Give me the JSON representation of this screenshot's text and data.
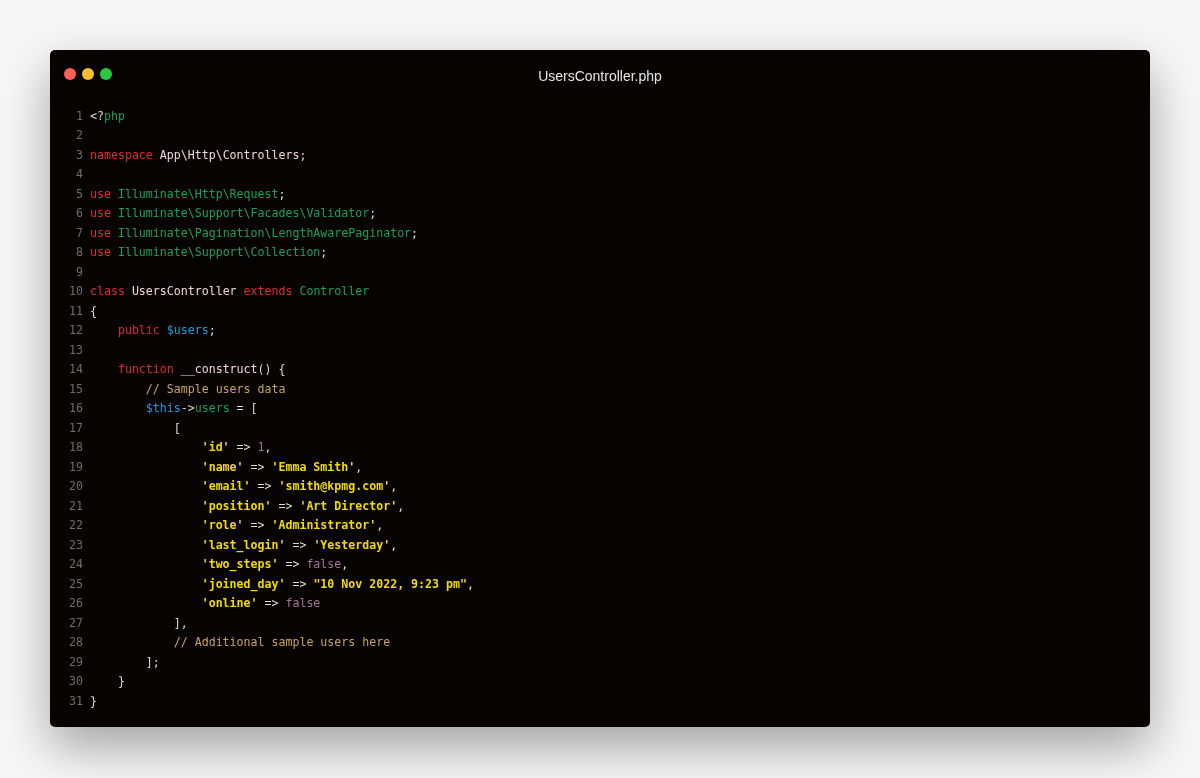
{
  "window": {
    "title": "UsersController.php"
  },
  "lines": [
    {
      "number": "1",
      "tokens": [
        {
          "text": "<?",
          "kind": "plain"
        },
        {
          "text": "php",
          "kind": "type"
        }
      ]
    },
    {
      "number": "2"
    },
    {
      "number": "3",
      "tokens": [
        {
          "text": "namespace",
          "kind": "keyword"
        },
        {
          "text": " App\\Http\\Controllers",
          "kind": "name"
        },
        {
          "text": ";",
          "kind": "plain"
        }
      ]
    },
    {
      "number": "4"
    },
    {
      "number": "5",
      "tokens": [
        {
          "text": "use",
          "kind": "keyword"
        },
        {
          "text": " Illuminate\\Http\\Request",
          "kind": "type"
        },
        {
          "text": ";",
          "kind": "plain"
        }
      ]
    },
    {
      "number": "6",
      "tokens": [
        {
          "text": "use",
          "kind": "keyword"
        },
        {
          "text": " Illuminate\\Support\\Facades\\Validator",
          "kind": "type"
        },
        {
          "text": ";",
          "kind": "plain"
        }
      ]
    },
    {
      "number": "7",
      "tokens": [
        {
          "text": "use",
          "kind": "keyword"
        },
        {
          "text": " Illuminate\\Pagination\\LengthAwarePaginator",
          "kind": "type"
        },
        {
          "text": ";",
          "kind": "plain"
        }
      ]
    },
    {
      "number": "8",
      "tokens": [
        {
          "text": "use",
          "kind": "keyword"
        },
        {
          "text": " Illuminate\\Support\\Collection",
          "kind": "type"
        },
        {
          "text": ";",
          "kind": "plain"
        }
      ]
    },
    {
      "number": "9"
    },
    {
      "number": "10",
      "tokens": [
        {
          "text": "class",
          "kind": "keyword"
        },
        {
          "text": " UsersController ",
          "kind": "name"
        },
        {
          "text": "extends",
          "kind": "keyword"
        },
        {
          "text": " Controller",
          "kind": "type"
        }
      ]
    },
    {
      "number": "11",
      "tokens": [
        {
          "text": "{",
          "kind": "plain"
        }
      ]
    },
    {
      "number": "12",
      "tokens": [
        {
          "text": "    public",
          "kind": "keyword"
        },
        {
          "text": " $users",
          "kind": "var"
        },
        {
          "text": ";",
          "kind": "plain"
        }
      ]
    },
    {
      "number": "13"
    },
    {
      "number": "14",
      "tokens": [
        {
          "text": "    function",
          "kind": "keyword"
        },
        {
          "text": " __construct",
          "kind": "name"
        },
        {
          "text": "() {",
          "kind": "plain"
        }
      ]
    },
    {
      "number": "15",
      "tokens": [
        {
          "text": "        // Sample users data",
          "kind": "comment"
        }
      ]
    },
    {
      "number": "16",
      "tokens": [
        {
          "text": "        $this",
          "kind": "var"
        },
        {
          "text": "->",
          "kind": "plain"
        },
        {
          "text": "users",
          "kind": "type"
        },
        {
          "text": " = [",
          "kind": "plain"
        }
      ]
    },
    {
      "number": "17",
      "tokens": [
        {
          "text": "            [",
          "kind": "plain"
        }
      ]
    },
    {
      "number": "18",
      "tokens": [
        {
          "text": "                'id'",
          "kind": "string"
        },
        {
          "text": " => ",
          "kind": "plain"
        },
        {
          "text": "1",
          "kind": "literal"
        },
        {
          "text": ",",
          "kind": "plain"
        }
      ]
    },
    {
      "number": "19",
      "tokens": [
        {
          "text": "                'name'",
          "kind": "string"
        },
        {
          "text": " => ",
          "kind": "plain"
        },
        {
          "text": "'Emma Smith'",
          "kind": "string"
        },
        {
          "text": ",",
          "kind": "plain"
        }
      ]
    },
    {
      "number": "20",
      "tokens": [
        {
          "text": "                'email'",
          "kind": "string"
        },
        {
          "text": " => ",
          "kind": "plain"
        },
        {
          "text": "'smith@kpmg.com'",
          "kind": "string"
        },
        {
          "text": ",",
          "kind": "plain"
        }
      ]
    },
    {
      "number": "21",
      "tokens": [
        {
          "text": "                'position'",
          "kind": "string"
        },
        {
          "text": " => ",
          "kind": "plain"
        },
        {
          "text": "'Art Director'",
          "kind": "string"
        },
        {
          "text": ",",
          "kind": "plain"
        }
      ]
    },
    {
      "number": "22",
      "tokens": [
        {
          "text": "                'role'",
          "kind": "string"
        },
        {
          "text": " => ",
          "kind": "plain"
        },
        {
          "text": "'Administrator'",
          "kind": "string"
        },
        {
          "text": ",",
          "kind": "plain"
        }
      ]
    },
    {
      "number": "23",
      "tokens": [
        {
          "text": "                'last_login'",
          "kind": "string"
        },
        {
          "text": " => ",
          "kind": "plain"
        },
        {
          "text": "'Yesterday'",
          "kind": "string"
        },
        {
          "text": ",",
          "kind": "plain"
        }
      ]
    },
    {
      "number": "24",
      "tokens": [
        {
          "text": "                'two_steps'",
          "kind": "string"
        },
        {
          "text": " => ",
          "kind": "plain"
        },
        {
          "text": "false",
          "kind": "literal"
        },
        {
          "text": ",",
          "kind": "plain"
        }
      ]
    },
    {
      "number": "25",
      "tokens": [
        {
          "text": "                'joined_day'",
          "kind": "string"
        },
        {
          "text": " => ",
          "kind": "plain"
        },
        {
          "text": "\"10 Nov 2022, 9:23 pm\"",
          "kind": "string"
        },
        {
          "text": ",",
          "kind": "plain"
        }
      ]
    },
    {
      "number": "26",
      "tokens": [
        {
          "text": "                'online'",
          "kind": "string"
        },
        {
          "text": " => ",
          "kind": "plain"
        },
        {
          "text": "false",
          "kind": "literal"
        }
      ]
    },
    {
      "number": "27",
      "tokens": [
        {
          "text": "            ],",
          "kind": "plain"
        }
      ]
    },
    {
      "number": "28",
      "tokens": [
        {
          "text": "            // Additional sample users here",
          "kind": "comment"
        }
      ]
    },
    {
      "number": "29",
      "tokens": [
        {
          "text": "        ];",
          "kind": "plain"
        }
      ]
    },
    {
      "number": "30",
      "tokens": [
        {
          "text": "    }",
          "kind": "plain"
        }
      ]
    },
    {
      "number": "31",
      "tokens": [
        {
          "text": "}",
          "kind": "plain"
        }
      ]
    }
  ]
}
